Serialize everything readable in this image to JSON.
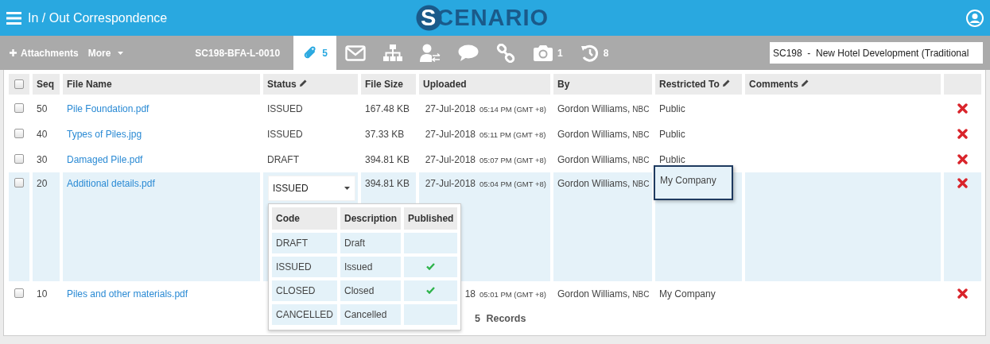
{
  "header": {
    "title": "In / Out Correspondence",
    "logo": "SCENARIO"
  },
  "toolbar": {
    "add_label": "Attachments",
    "more_label": "More",
    "reference": "SC198-BFA-L-0010",
    "tabs": [
      {
        "kind": "attachments",
        "count": "5",
        "selected": true
      },
      {
        "kind": "mail",
        "selected": false
      },
      {
        "kind": "hierarchy",
        "selected": false
      },
      {
        "kind": "user-transfer",
        "selected": false
      },
      {
        "kind": "chat",
        "selected": false
      },
      {
        "kind": "link",
        "selected": false
      },
      {
        "kind": "camera",
        "count": "1",
        "selected": false
      },
      {
        "kind": "history",
        "count": "8",
        "selected": false
      }
    ],
    "project": {
      "value": "SC198  -  New Hotel Development (Traditional"
    }
  },
  "table": {
    "all_checked": false,
    "columns": [
      {
        "label": "Seq",
        "editable": false
      },
      {
        "label": "File Name",
        "editable": false
      },
      {
        "label": "Status",
        "editable": true
      },
      {
        "label": "File Size",
        "editable": false
      },
      {
        "label": "Uploaded",
        "editable": false
      },
      {
        "label": "By",
        "editable": false
      },
      {
        "label": "Restricted To",
        "editable": true
      },
      {
        "label": "Comments",
        "editable": true
      }
    ],
    "rows": [
      {
        "seq": "50",
        "file": "Pile Foundation.pdf",
        "status": "ISSUED",
        "size": "167.48 KB",
        "date": "27-Jul-2018",
        "time": "05:14 PM (GMT +8)",
        "by": "Gordon Williams,",
        "org": "NBC",
        "restricted": "Public",
        "selected": false,
        "editing": false,
        "checked": false
      },
      {
        "seq": "40",
        "file": "Types of Piles.jpg",
        "status": "ISSUED",
        "size": "37.33 KB",
        "date": "27-Jul-2018",
        "time": "05:11 PM (GMT +8)",
        "by": "Gordon Williams,",
        "org": "NBC",
        "restricted": "Public",
        "selected": false,
        "editing": false,
        "checked": false
      },
      {
        "seq": "30",
        "file": "Damaged Pile.pdf",
        "status": "DRAFT",
        "size": "394.81 KB",
        "date": "27-Jul-2018",
        "time": "05:07 PM (GMT +8)",
        "by": "Gordon Williams,",
        "org": "NBC",
        "restricted": "Public",
        "selected": false,
        "editing": false,
        "checked": false
      },
      {
        "seq": "20",
        "file": "Additional details.pdf",
        "status": "ISSUED",
        "size": "394.81 KB",
        "date": "27-Jul-2018",
        "time": "05:04 PM (GMT +8)",
        "by": "Gordon Williams,",
        "org": "NBC",
        "restricted": "My Company",
        "selected": true,
        "editing": true,
        "checked": false
      },
      {
        "seq": "10",
        "file": "Piles and other materials.pdf",
        "date": "18",
        "time": "05:01 PM (GMT +8)",
        "by": "Gordon Williams,",
        "org": "NBC",
        "restricted": "My Company",
        "selected": false,
        "editing": false,
        "checked": false
      }
    ],
    "record_count": "5 Records"
  },
  "status_dropdown": {
    "columns": [
      "Code",
      "Description",
      "Published"
    ],
    "options": [
      {
        "code": "DRAFT",
        "description": "Draft",
        "published": false
      },
      {
        "code": "ISSUED",
        "description": "Issued",
        "published": true
      },
      {
        "code": "CLOSED",
        "description": "Closed",
        "published": true
      },
      {
        "code": "CANCELLED",
        "description": "Cancelled",
        "published": false
      }
    ]
  }
}
